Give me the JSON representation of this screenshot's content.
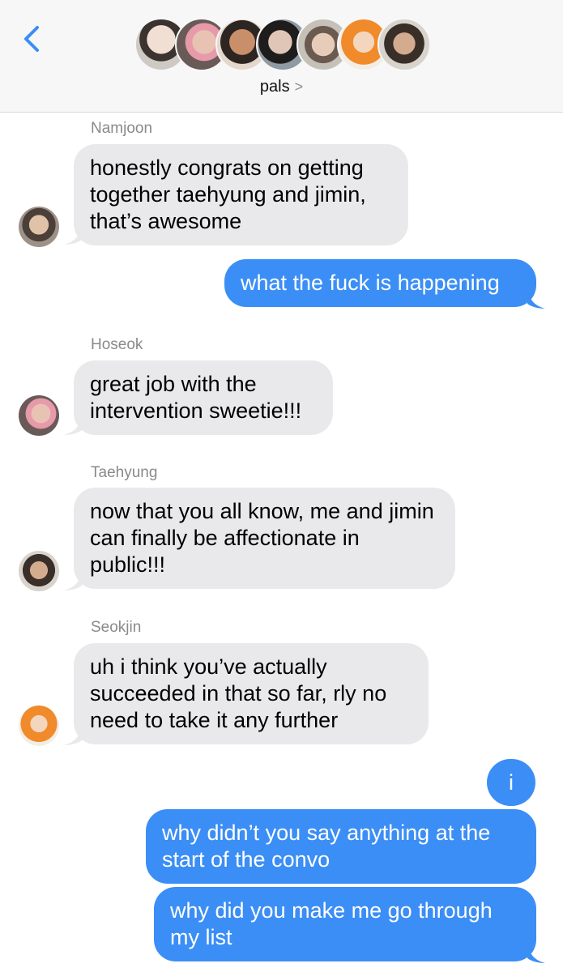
{
  "header": {
    "back_label": "<",
    "group_name": "pals",
    "group_chevron": ">",
    "participant_avatars": [
      "person-1",
      "person-2",
      "person-3",
      "person-4",
      "person-5",
      "person-6",
      "person-7"
    ]
  },
  "messages": [
    {
      "sender": "Namjoon",
      "text": "honestly congrats on getting together taehyung and jimin, that’s awesome",
      "direction": "incoming"
    },
    {
      "sender": "",
      "text": "what the fuck is happening",
      "direction": "outgoing"
    },
    {
      "sender": "Hoseok",
      "text": "great job with the intervention sweetie!!!",
      "direction": "incoming"
    },
    {
      "sender": "Taehyung",
      "text": "now that you all know, me and jimin can finally be affectionate in public!!!",
      "direction": "incoming"
    },
    {
      "sender": "Seokjin",
      "text": "uh i think you’ve actually succeeded in that so far, rly no need to take it any further",
      "direction": "incoming"
    },
    {
      "sender": "",
      "text": "i",
      "direction": "outgoing"
    },
    {
      "sender": "",
      "text": "why didn’t you say anything at the start of the convo",
      "direction": "outgoing"
    },
    {
      "sender": "",
      "text": "why did you make me go through my list",
      "direction": "outgoing"
    }
  ],
  "colors": {
    "accent_blue": "#3b8ef5",
    "incoming_bubble": "#e9e9eb",
    "header_bg": "#f7f7f7"
  }
}
